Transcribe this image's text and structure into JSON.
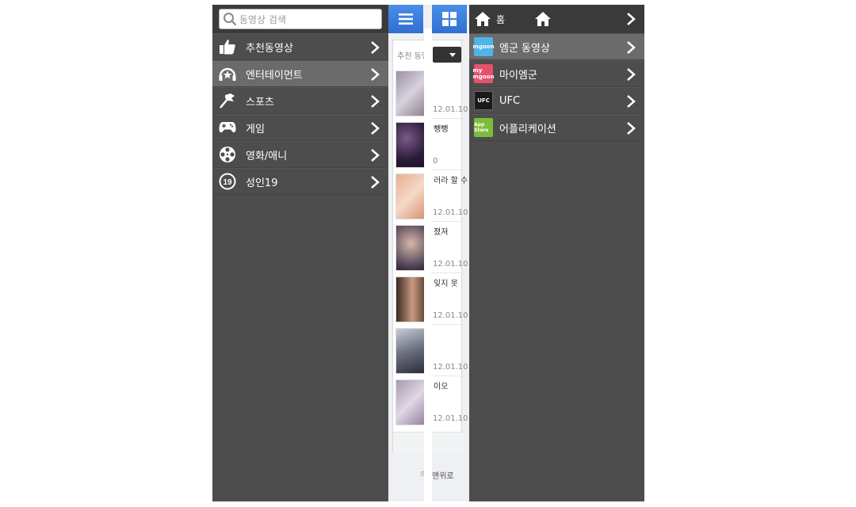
{
  "left_menu": {
    "search_placeholder": "동영상 검색",
    "items": [
      {
        "label": "추천동영상",
        "icon": "thumbs-up-icon"
      },
      {
        "label": "엔터테이먼트",
        "icon": "headphones-star-icon"
      },
      {
        "label": "스포츠",
        "icon": "sports-flag-icon"
      },
      {
        "label": "게임",
        "icon": "gamepad-icon"
      },
      {
        "label": "영화/애니",
        "icon": "film-reel-icon"
      },
      {
        "label": "성인19",
        "icon": "age-19-icon"
      }
    ],
    "active_index": 1
  },
  "middle": {
    "menu_button_icon": "hamburger-menu-icon",
    "grid_button_icon": "grid-icon",
    "category_label": "추천 동영",
    "videos": [
      {
        "title": "",
        "date": "12.01.10"
      },
      {
        "title": "뺑뺑",
        "date": "0"
      },
      {
        "title": "러라 할 수",
        "date": "12.01.10"
      },
      {
        "title": "졌져",
        "date": "12.01.10"
      },
      {
        "title": "잊지 못",
        "date": "12.01.10"
      },
      {
        "title": "",
        "date": "12.01.10"
      },
      {
        "title": "이오",
        "date": "12.01.10"
      }
    ],
    "top_link": "맨위로",
    "footer_fragment": "의"
  },
  "right_menu": {
    "home_label": "홈",
    "items": [
      {
        "label": "엠군 동영상",
        "logo": "mgoon",
        "color": "#4fb4ea"
      },
      {
        "label": "마이엠군",
        "logo": "my mgoon",
        "color": "#e8506a"
      },
      {
        "label": "UFC",
        "logo": "UFC",
        "color": "#1a1a1a"
      },
      {
        "label": "어플리케이션",
        "logo": "App Store",
        "color": "#7dbb3a"
      }
    ],
    "active_index": 0
  },
  "colors": {
    "panel_bg": "#4d4d4d",
    "header_bg": "#3a3a3a",
    "active_bg": "#6b6b6b",
    "accent_blue": "#2f6fd0"
  }
}
